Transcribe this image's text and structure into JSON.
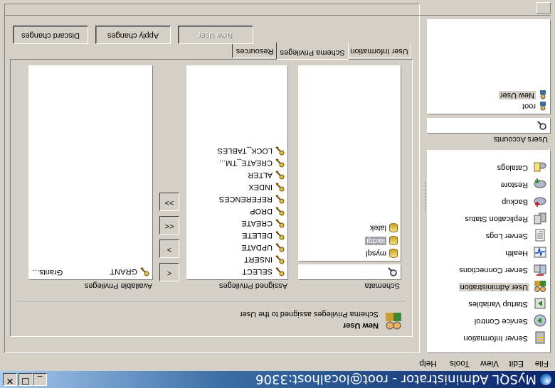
{
  "window": {
    "title": "MySQL Administrator - root@localhost:3306",
    "controls": {
      "minimize": "_",
      "maximize": "☐",
      "close": "✕"
    }
  },
  "menu": [
    "File",
    "Edit",
    "View",
    "Tools",
    "Help"
  ],
  "nav": {
    "items": [
      {
        "label": "Server Information",
        "icon": "server-information-icon"
      },
      {
        "label": "Service Control",
        "icon": "service-control-icon"
      },
      {
        "label": "Startup Variables",
        "icon": "startup-variables-icon"
      },
      {
        "label": "User Administration",
        "icon": "user-administration-icon",
        "selected": true
      },
      {
        "label": "Server Connections",
        "icon": "server-connections-icon"
      },
      {
        "label": "Health",
        "icon": "health-icon"
      },
      {
        "label": "Server Logs",
        "icon": "server-logs-icon"
      },
      {
        "label": "Replication Status",
        "icon": "replication-status-icon"
      },
      {
        "label": "Backup",
        "icon": "backup-icon"
      },
      {
        "label": "Restore",
        "icon": "restore-icon"
      },
      {
        "label": "Catalogs",
        "icon": "catalogs-icon"
      }
    ]
  },
  "users": {
    "section_label": "Users Accounts",
    "search_value": "",
    "items": [
      {
        "label": "root",
        "icon": "user-icon"
      },
      {
        "label": "New User",
        "icon": "user-icon",
        "selected": true
      }
    ]
  },
  "tabs": [
    {
      "label": "User Information",
      "active": false
    },
    {
      "label": "Schema Privileges",
      "active": true
    },
    {
      "label": "Resources",
      "active": false
    }
  ],
  "header": {
    "user_name": "New User",
    "subtitle": "Schema Privileges assigned to the User"
  },
  "schemata": {
    "label": "Schemata",
    "search_value": "",
    "items": [
      {
        "label": "mysql"
      },
      {
        "label": "iaidqi",
        "selected": true
      },
      {
        "label": "latek"
      }
    ]
  },
  "assigned": {
    "label": "Assigned Privileges",
    "items": [
      "SELECT",
      "INSERT",
      "UPDATE",
      "DELETE",
      "CREATE",
      "DROP",
      "REFERENCES",
      "INDEX",
      "ALTER",
      "CREATE_TM...",
      "LOCK_TABLES"
    ]
  },
  "transfer_buttons": {
    "add_one": "<",
    "remove_one": ">",
    "add_all": "<<",
    "remove_all": ">>"
  },
  "available": {
    "label": "Available Privileges",
    "items": [
      {
        "name": "GRANT",
        "desc": "Grants..."
      }
    ]
  },
  "actions": {
    "discard": "Discard changes",
    "apply": "Apply changes",
    "new_user": "New User"
  },
  "colors": {
    "titlebar_start": "#0a246a",
    "titlebar_end": "#a6caf0",
    "face": "#d4d0c8",
    "selection": "#d4d0c8"
  }
}
